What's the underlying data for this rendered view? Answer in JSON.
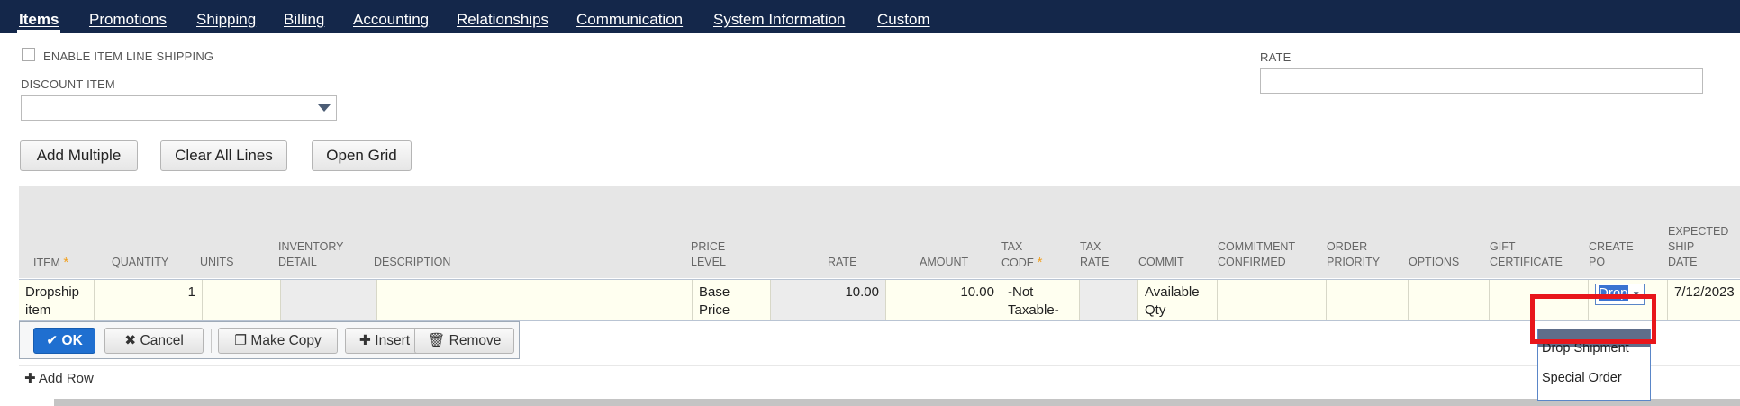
{
  "tabs": [
    {
      "label": "Items"
    },
    {
      "label": "Promotions"
    },
    {
      "label": "Shipping"
    },
    {
      "label": "Billing"
    },
    {
      "label": "Accounting"
    },
    {
      "label": "Relationships"
    },
    {
      "label": "Communication"
    },
    {
      "label": "System Information"
    },
    {
      "label": "Custom"
    }
  ],
  "form": {
    "enable_shipping_label": "ENABLE ITEM LINE SHIPPING",
    "discount_item_label": "DISCOUNT ITEM",
    "rate_label": "RATE"
  },
  "toolbar": {
    "add_multiple": "Add Multiple",
    "clear_all_lines": "Clear All Lines",
    "open_grid": "Open Grid"
  },
  "columns": {
    "item": "ITEM",
    "quantity": "QUANTITY",
    "units": "UNITS",
    "inventory_detail_1": "INVENTORY",
    "inventory_detail_2": "DETAIL",
    "description": "DESCRIPTION",
    "price_level_1": "PRICE",
    "price_level_2": "LEVEL",
    "rate": "RATE",
    "amount": "AMOUNT",
    "tax_code_1": "TAX",
    "tax_code_2": "CODE",
    "tax_rate_1": "TAX",
    "tax_rate_2": "RATE",
    "commit": "COMMIT",
    "commitment_confirmed_1": "COMMITMENT",
    "commitment_confirmed_2": "CONFIRMED",
    "order_priority_1": "ORDER",
    "order_priority_2": "PRIORITY",
    "options": "OPTIONS",
    "gift_certificate_1": "GIFT",
    "gift_certificate_2": "CERTIFICATE",
    "create_po_1": "CREATE",
    "create_po_2": "PO",
    "expected_ship_date_1": "EXPECTED",
    "expected_ship_date_2": "SHIP",
    "expected_ship_date_3": "DATE",
    "required_mark": "*"
  },
  "row": {
    "item_1": "Dropship",
    "item_2": "item",
    "quantity": "1",
    "price_level_1": "Base",
    "price_level_2": "Price",
    "rate": "10.00",
    "amount": "10.00",
    "tax_code_1": "-Not",
    "tax_code_2": "Taxable-",
    "commit_1": "Available",
    "commit_2": "Qty",
    "create_po": "Drop",
    "expected_ship_date": "7/12/2023"
  },
  "row_actions": {
    "ok": "OK",
    "cancel": "Cancel",
    "make_copy": "Make Copy",
    "insert": "Insert",
    "remove": "Remove",
    "add_row": "Add Row"
  },
  "dropdown": {
    "options": [
      "Drop Shipment",
      "Special Order"
    ]
  },
  "colors": {
    "tab_bar": "#14274a",
    "ok_button": "#1f6fd0",
    "highlight": "#e8161b"
  }
}
